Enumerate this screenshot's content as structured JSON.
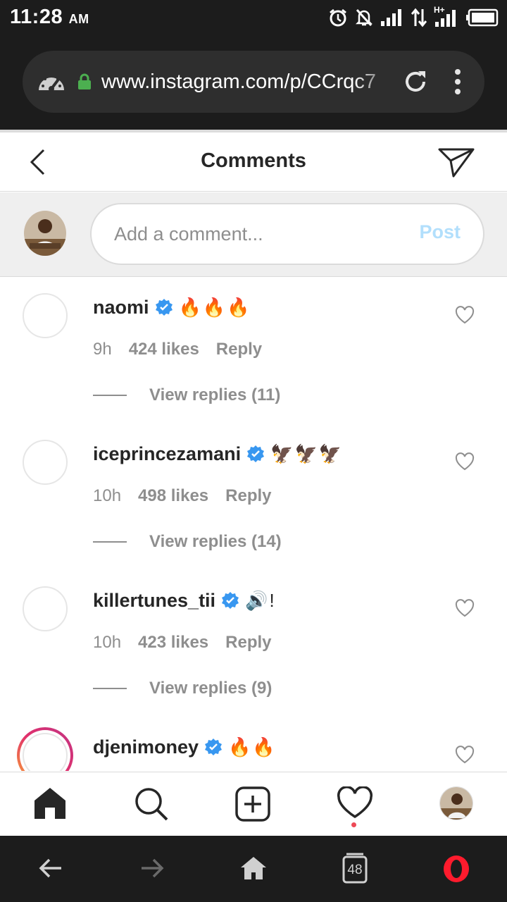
{
  "status_bar": {
    "time": "11:28",
    "ampm": "AM",
    "network_label": "H+"
  },
  "browser": {
    "url": "www.instagram.com/p/CCrqc7",
    "icons": [
      "speedometer-icon",
      "lock-icon",
      "reload-icon",
      "more-vert-icon"
    ]
  },
  "header": {
    "title": "Comments"
  },
  "composer": {
    "placeholder": "Add a comment...",
    "post_label": "Post"
  },
  "comments": [
    {
      "username": "naomi",
      "verified": true,
      "text": "🔥🔥🔥",
      "time": "9h",
      "likes": "424 likes",
      "reply": "Reply",
      "view_replies": "View replies (11)"
    },
    {
      "username": "iceprincezamani",
      "verified": true,
      "text": "🦅🦅🦅",
      "time": "10h",
      "likes": "498 likes",
      "reply": "Reply",
      "view_replies": "View replies (14)"
    },
    {
      "username": "killertunes_tii",
      "verified": true,
      "text": "🔊!",
      "time": "10h",
      "likes": "423 likes",
      "reply": "Reply",
      "view_replies": "View replies (9)"
    },
    {
      "username": "djenimoney",
      "verified": true,
      "text": "🔥🔥",
      "has_story": true
    }
  ],
  "bottom_nav": {
    "items": [
      "home-icon",
      "search-icon",
      "new-post-icon",
      "activity-heart-icon",
      "profile-avatar"
    ]
  },
  "opera_bar": {
    "tabs_count": "48",
    "items": [
      "back-icon",
      "forward-icon",
      "home-icon",
      "tabs-icon",
      "opera-menu-icon"
    ]
  },
  "colors": {
    "verified": "#3897f0",
    "post_disabled": "#b2dffc",
    "meta_gray": "#8e8e8e",
    "dark_bar": "#1c1c1c",
    "opera_red": "#ff1b2d",
    "lock_green": "#4caf50"
  }
}
